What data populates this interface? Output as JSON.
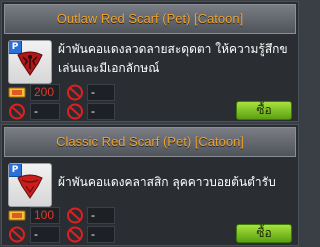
{
  "items": [
    {
      "title": "Outlaw Red Scarf (Pet) [Catoon]",
      "badge": "P",
      "description": "ผ้าพันคอแดงลวดลายสะดุดตา ให้ความรู้สึกขเล่นและมีเอกลักษณ์",
      "prices": [
        {
          "left_value": "200",
          "right_value": "-"
        },
        {
          "left_value": "-",
          "right_value": "-"
        }
      ],
      "buy_label": "ซื้อ",
      "icon": "scarf-pattern-icon"
    },
    {
      "title": "Classic Red Scarf (Pet) [Catoon]",
      "badge": "P",
      "description": "ผ้าพันคอแดงคลาสสิก ลุคคาวบอยต้นตำรับ",
      "prices": [
        {
          "left_value": "100",
          "right_value": "-"
        },
        {
          "left_value": "-",
          "right_value": "-"
        }
      ],
      "buy_label": "ซื้อ",
      "icon": "scarf-classic-icon"
    }
  ],
  "colors": {
    "title": "#f0a02a",
    "price_red": "#e23a2a",
    "buy_green": "#7cc41e",
    "pet_badge": "#2b6fd8"
  }
}
